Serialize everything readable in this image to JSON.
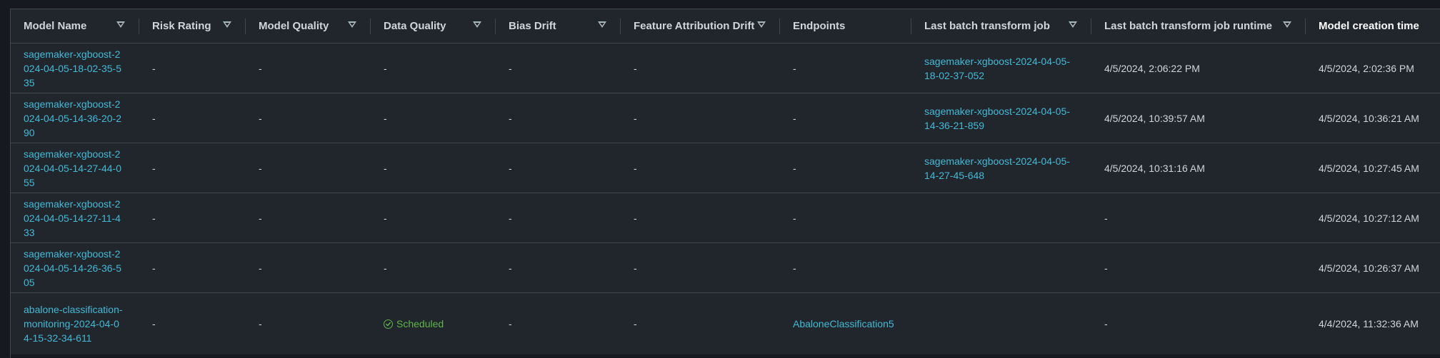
{
  "columns": [
    {
      "label": "Model Name",
      "filterable": true
    },
    {
      "label": "Risk Rating",
      "filterable": true
    },
    {
      "label": "Model Quality",
      "filterable": true
    },
    {
      "label": "Data Quality",
      "filterable": true
    },
    {
      "label": "Bias Drift",
      "filterable": true
    },
    {
      "label": "Feature Attribution Drift",
      "filterable": true
    },
    {
      "label": "Endpoints",
      "filterable": false
    },
    {
      "label": "Last batch transform job",
      "filterable": true
    },
    {
      "label": "Last batch transform job runtime",
      "filterable": true
    },
    {
      "label": "Model creation time",
      "filterable": false,
      "sorted": true
    }
  ],
  "rows": [
    {
      "model_name": "sagemaker-xgboost-2024-04-05-18-02-35-535",
      "risk_rating": "-",
      "model_quality": "-",
      "data_quality": "-",
      "bias_drift": "-",
      "feature_attribution_drift": "-",
      "endpoints": "-",
      "last_batch_job": "sagemaker-xgboost-2024-04-05-18-02-37-052",
      "last_batch_runtime": "4/5/2024, 2:06:22 PM",
      "creation_time": "4/5/2024, 2:02:36 PM"
    },
    {
      "model_name": "sagemaker-xgboost-2024-04-05-14-36-20-290",
      "risk_rating": "-",
      "model_quality": "-",
      "data_quality": "-",
      "bias_drift": "-",
      "feature_attribution_drift": "-",
      "endpoints": "-",
      "last_batch_job": "sagemaker-xgboost-2024-04-05-14-36-21-859",
      "last_batch_runtime": "4/5/2024, 10:39:57 AM",
      "creation_time": "4/5/2024, 10:36:21 AM"
    },
    {
      "model_name": "sagemaker-xgboost-2024-04-05-14-27-44-055",
      "risk_rating": "-",
      "model_quality": "-",
      "data_quality": "-",
      "bias_drift": "-",
      "feature_attribution_drift": "-",
      "endpoints": "-",
      "last_batch_job": "sagemaker-xgboost-2024-04-05-14-27-45-648",
      "last_batch_runtime": "4/5/2024, 10:31:16 AM",
      "creation_time": "4/5/2024, 10:27:45 AM"
    },
    {
      "model_name": "sagemaker-xgboost-2024-04-05-14-27-11-433",
      "risk_rating": "-",
      "model_quality": "-",
      "data_quality": "-",
      "bias_drift": "-",
      "feature_attribution_drift": "-",
      "endpoints": "-",
      "last_batch_job": "",
      "last_batch_runtime": "-",
      "creation_time": "4/5/2024, 10:27:12 AM"
    },
    {
      "model_name": "sagemaker-xgboost-2024-04-05-14-26-36-505",
      "risk_rating": "-",
      "model_quality": "-",
      "data_quality": "-",
      "bias_drift": "-",
      "feature_attribution_drift": "-",
      "endpoints": "-",
      "last_batch_job": "",
      "last_batch_runtime": "-",
      "creation_time": "4/5/2024, 10:26:37 AM"
    },
    {
      "model_name": "abalone-classification-monitoring-2024-04-04-15-32-34-611",
      "risk_rating": "-",
      "model_quality": "-",
      "data_quality": "Scheduled",
      "bias_drift": "-",
      "feature_attribution_drift": "-",
      "endpoints": "AbaloneClassification5",
      "last_batch_job": "",
      "last_batch_runtime": "-",
      "creation_time": "4/4/2024, 11:32:36 AM"
    }
  ],
  "icons": {
    "filter": "filter-caret-icon",
    "status_ok": "check-circle-icon"
  },
  "colors": {
    "link": "#44b9d6",
    "success": "#5eb64a",
    "background": "#21252c",
    "border": "#414750"
  }
}
